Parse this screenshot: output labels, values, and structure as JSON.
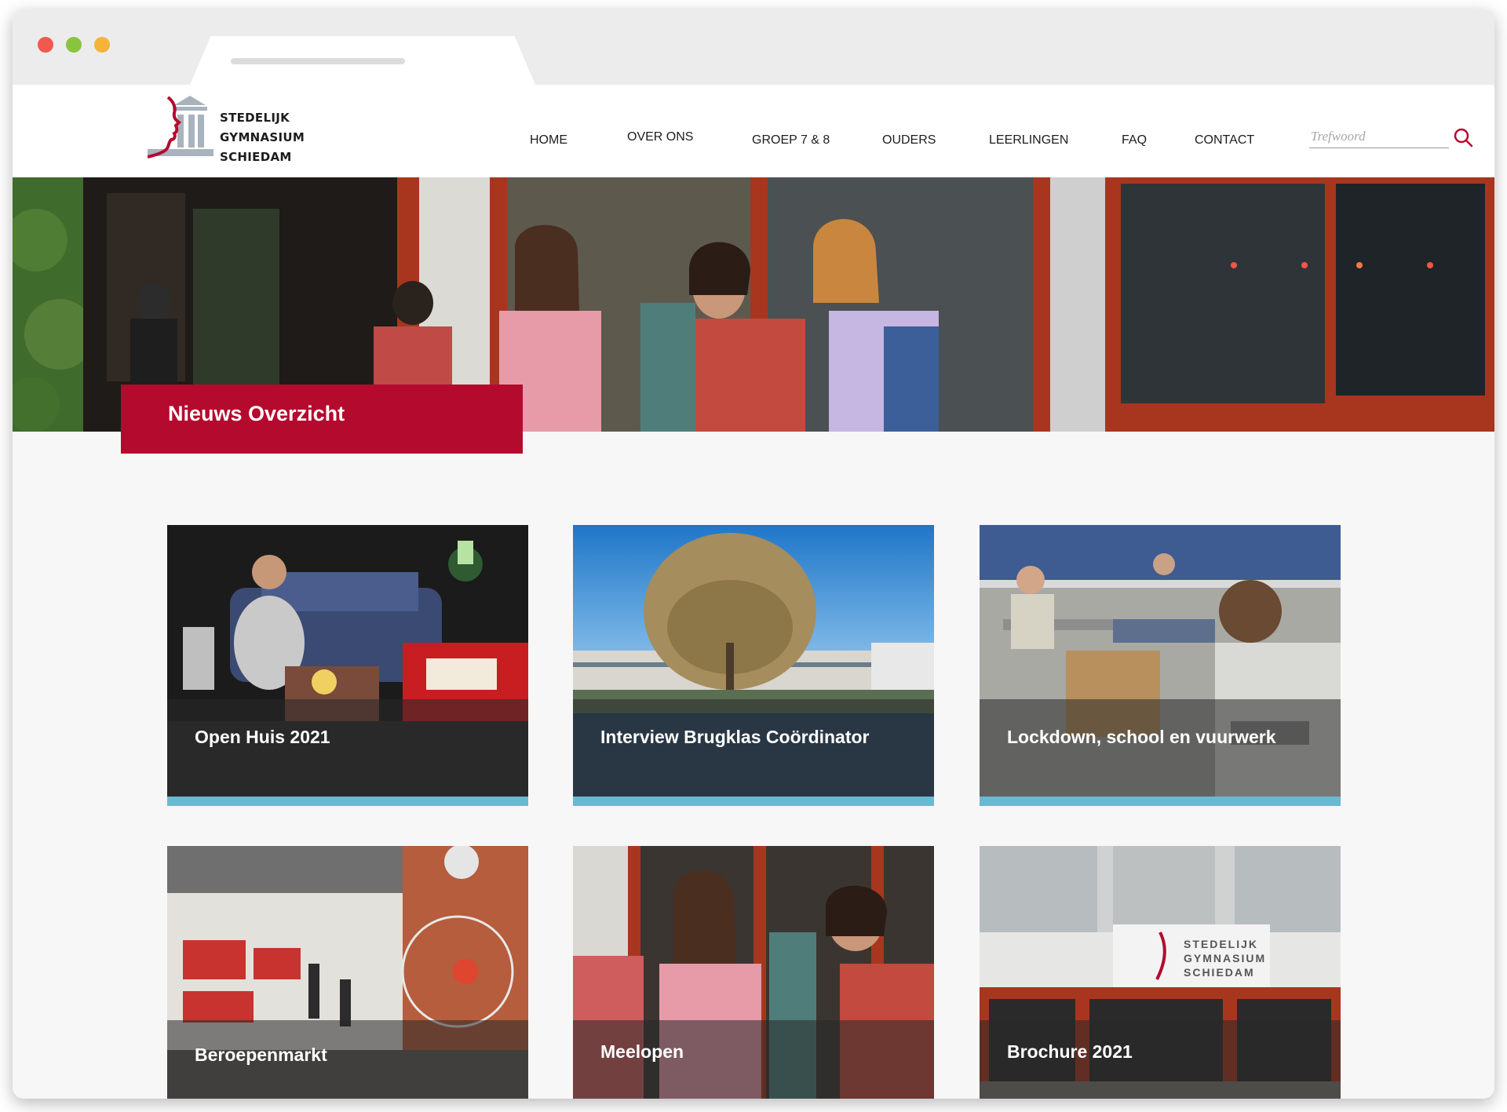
{
  "site": {
    "logo": {
      "line1": "STEDELIJK",
      "line2": "GYMNASIUM",
      "line3": "SCHIEDAM"
    },
    "nav": [
      "HOME",
      "OVER ONS",
      "GROEP 7 & 8",
      "OUDERS",
      "LEERLINGEN",
      "FAQ",
      "CONTACT"
    ],
    "search": {
      "placeholder": "Trefwoord",
      "icon": "search-icon"
    }
  },
  "hero": {
    "title": "Nieuws Overzicht"
  },
  "news": [
    {
      "title": "Open Huis 2021"
    },
    {
      "title": "Interview Brugklas Coördinator"
    },
    {
      "title": "Lockdown, school en vuurwerk"
    },
    {
      "title": "Beroepenmarkt"
    },
    {
      "title": "Meelopen"
    },
    {
      "title": "Brochure 2021"
    }
  ],
  "colors": {
    "brand_red": "#b40a2e",
    "card_accent": "#6bb8d3",
    "page_bg": "#f7f7f7"
  }
}
